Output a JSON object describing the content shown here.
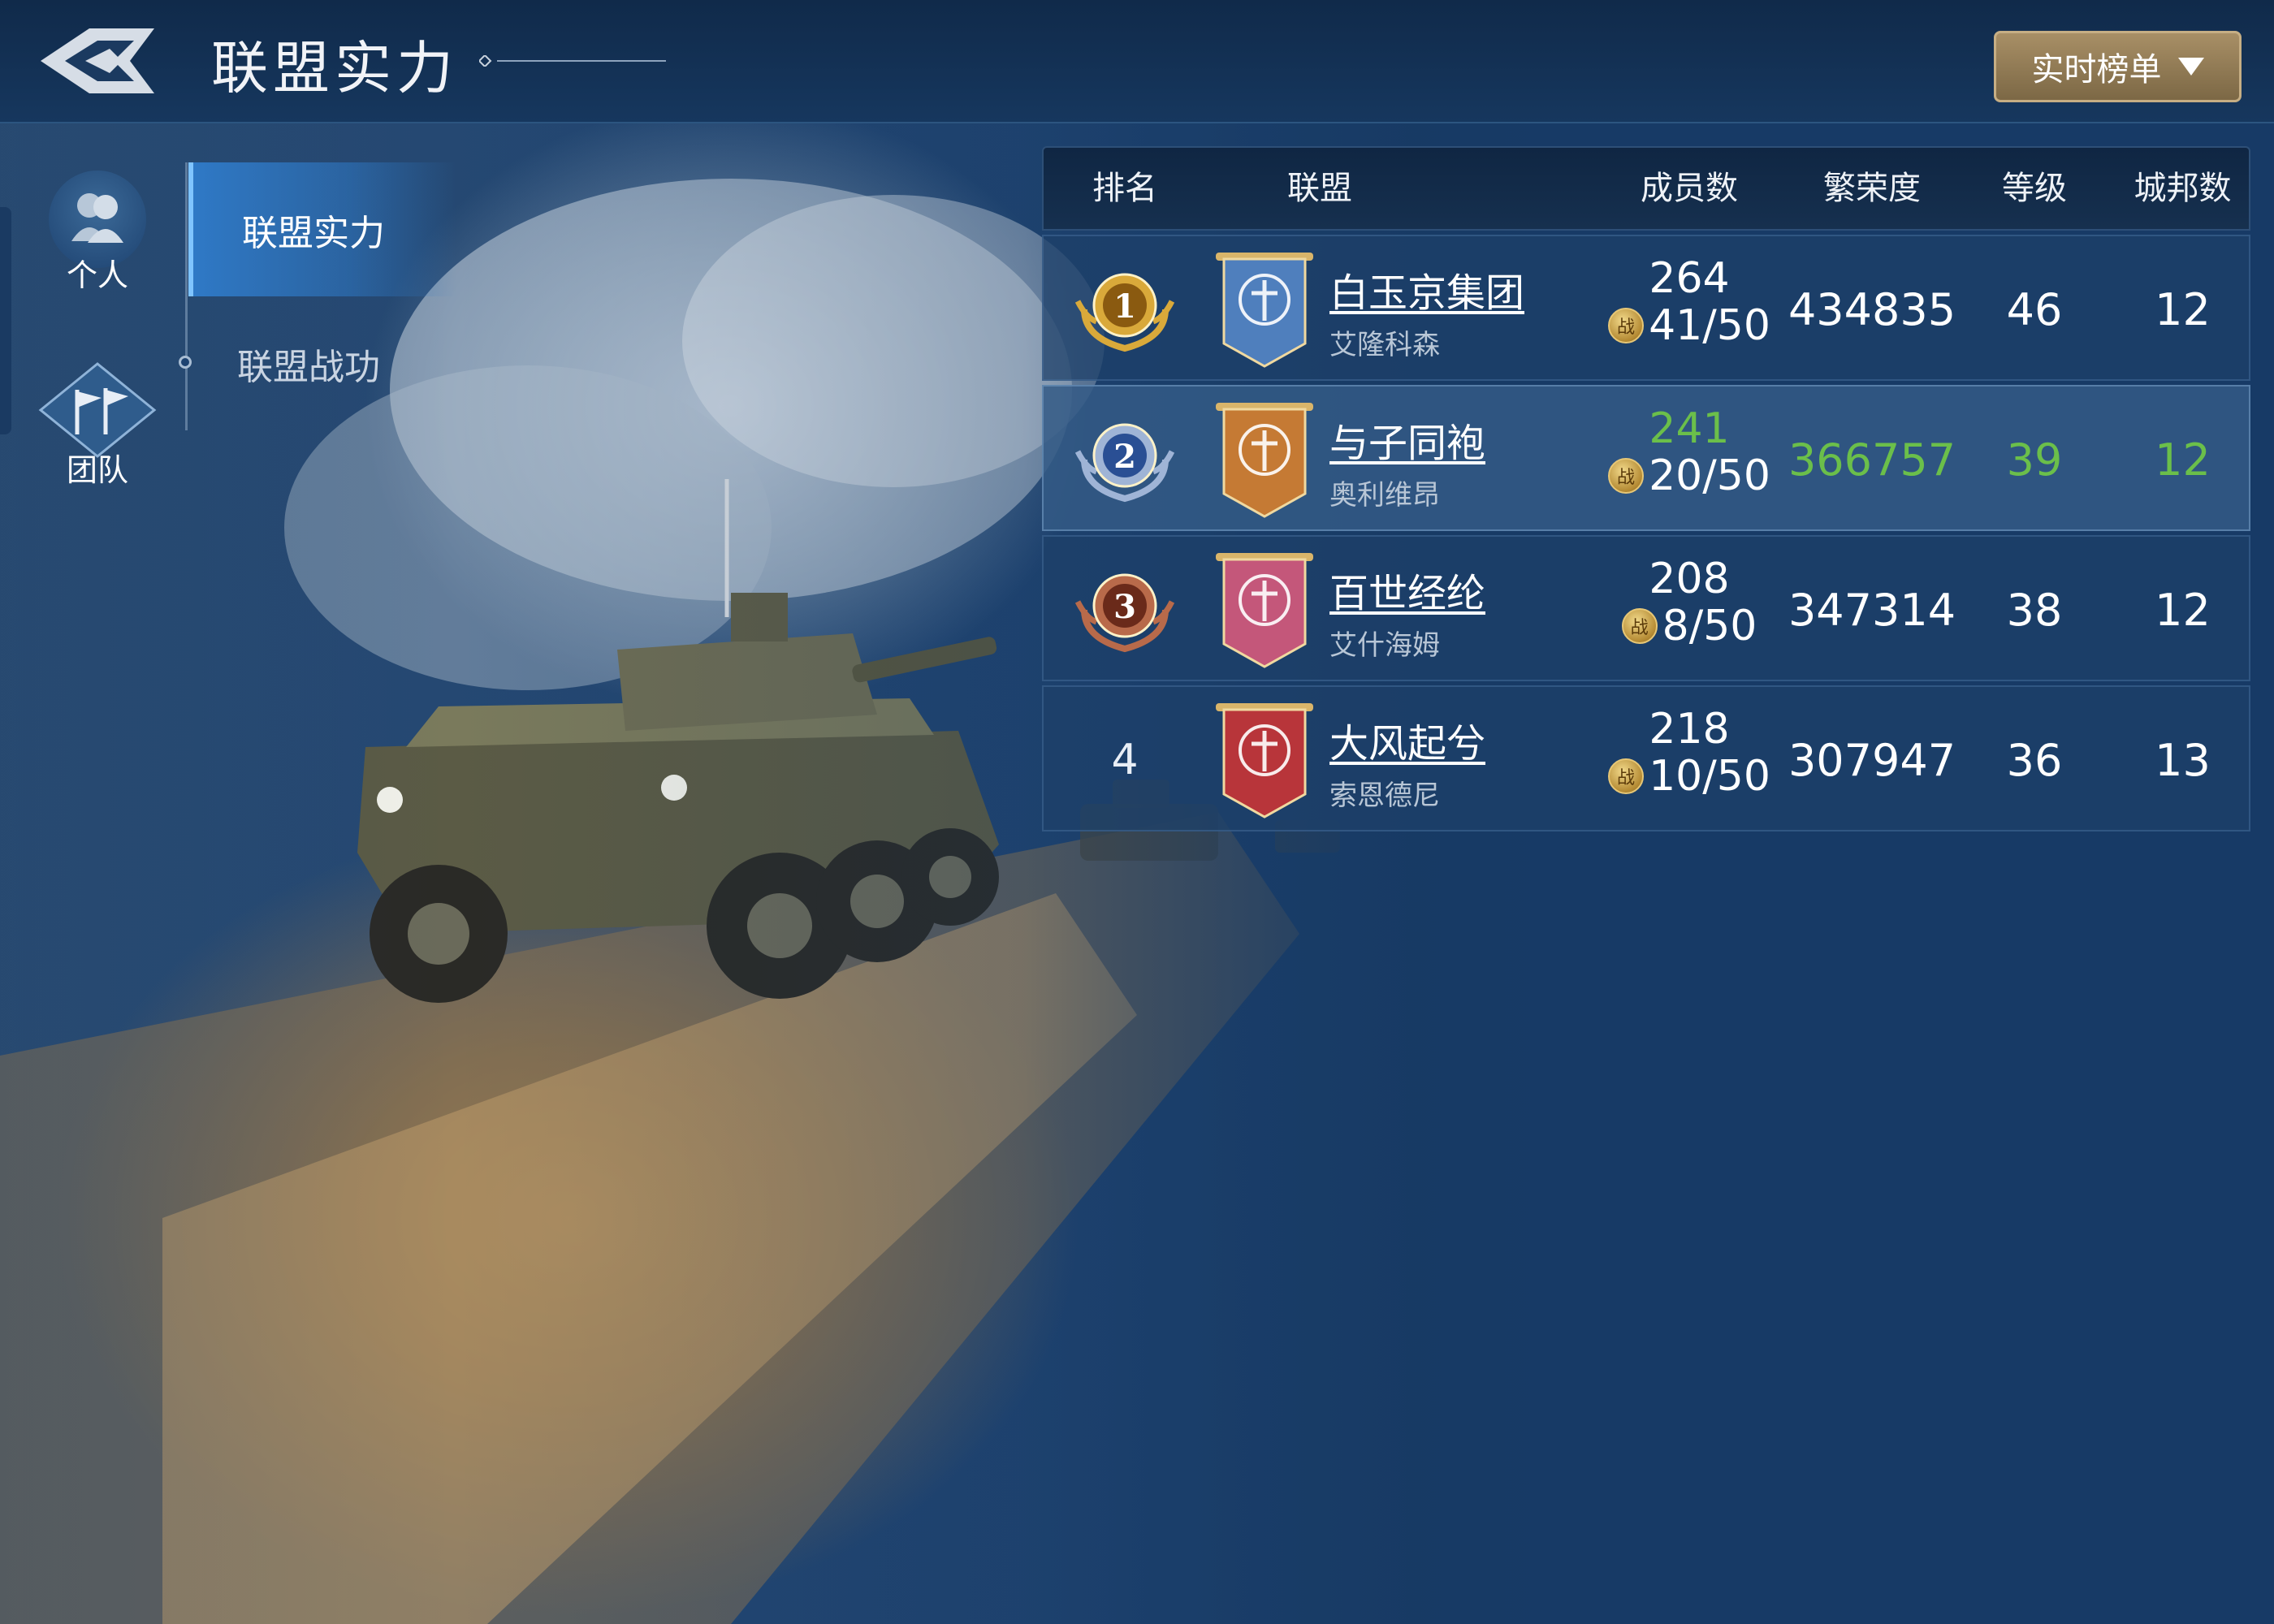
{
  "header": {
    "title": "联盟实力",
    "dropdown_label": "实时榜单"
  },
  "sidebar": {
    "items": [
      {
        "label": "个人",
        "icon": "person-icon"
      },
      {
        "label": "团队",
        "icon": "team-flag-icon"
      }
    ]
  },
  "subnav": {
    "items": [
      {
        "label": "联盟实力",
        "active": true
      },
      {
        "label": "联盟战功",
        "active": false
      }
    ]
  },
  "table": {
    "columns": [
      "排名",
      "联盟",
      "成员数",
      "繁荣度",
      "等级",
      "城邦数"
    ],
    "rows": [
      {
        "rank": "1",
        "medal": "gold",
        "banner_color": "#4f7fbd",
        "name": "白玉京集团",
        "leader": "艾隆科森",
        "members": "264",
        "members_cap": "41/50",
        "prosperity": "434835",
        "level": "46",
        "cities": "12",
        "highlight": false
      },
      {
        "rank": "2",
        "medal": "silver",
        "banner_color": "#c57a34",
        "name": "与子同袍",
        "leader": "奥利维昂",
        "members": "241",
        "members_cap": "20/50",
        "prosperity": "366757",
        "level": "39",
        "cities": "12",
        "highlight": true
      },
      {
        "rank": "3",
        "medal": "bronze",
        "banner_color": "#c4577a",
        "name": "百世经纶",
        "leader": "艾什海姆",
        "members": "208",
        "members_cap": "8/50",
        "prosperity": "347314",
        "level": "38",
        "cities": "12",
        "highlight": false
      },
      {
        "rank": "4",
        "medal": "none",
        "banner_color": "#b8353a",
        "name": "大风起兮",
        "leader": "索恩德尼",
        "members": "218",
        "members_cap": "10/50",
        "prosperity": "307947",
        "level": "36",
        "cities": "13",
        "highlight": false
      }
    ]
  },
  "coin_label": "战",
  "colors": {
    "highlight_text": "#6bbf4a",
    "gold": "#d9a93a",
    "silver": "#9fb4d6",
    "bronze": "#b86a4a"
  }
}
